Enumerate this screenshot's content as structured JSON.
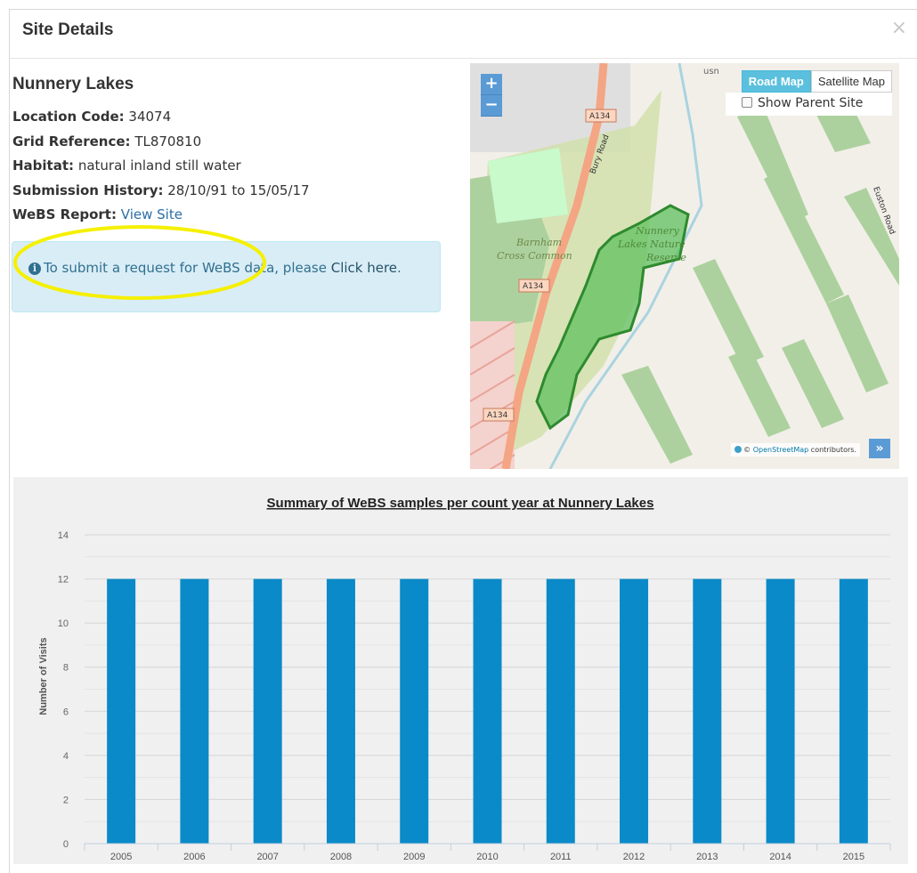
{
  "modal": {
    "title": "Site Details",
    "close_label": "×"
  },
  "site": {
    "name": "Nunnery Lakes",
    "details": [
      {
        "label": "Location Code:",
        "value": "34074"
      },
      {
        "label": "Grid Reference:",
        "value": "TL870810"
      },
      {
        "label": "Habitat:",
        "value": "natural inland still water"
      },
      {
        "label": "Submission History:",
        "value": "28/10/91 to 15/05/17"
      }
    ],
    "webs_report_label": "WeBS Report:",
    "webs_report_link": "View Site"
  },
  "alert": {
    "text": "To submit a request for WeBS data, please ",
    "link": "Click here",
    "end": "."
  },
  "map": {
    "zoom_in": "+",
    "zoom_out": "−",
    "road_map": "Road Map",
    "satellite_map": "Satellite Map",
    "show_parent_site": "Show Parent Site",
    "attribution_link": "OpenStreetMap",
    "attribution_text": " contributors.",
    "expand": "»",
    "labels": {
      "road_a134": "A134",
      "bury_road": "Bury Road",
      "barnham": "Barnham",
      "cross_common": "Cross Common",
      "nunnery": "Nunnery",
      "lakes_nature": "Lakes Nature",
      "reserve": "Reserve",
      "euston_road": "Euston Road",
      "usn": "usn"
    },
    "colors": {
      "background": "#f2efe9",
      "reserve_fill": "#5fc05f",
      "reserve_stroke": "#2e8a2e",
      "common": "#cfe0a8",
      "wood": "#add19e",
      "road": "#f4a583"
    }
  },
  "chart_data": {
    "type": "bar",
    "title": "Summary of WeBS samples per count year at Nunnery Lakes",
    "xlabel": "",
    "ylabel": "Number of Visits",
    "categories": [
      "2005",
      "2006",
      "2007",
      "2008",
      "2009",
      "2010",
      "2011",
      "2012",
      "2013",
      "2014",
      "2015"
    ],
    "values": [
      12,
      12,
      12,
      12,
      12,
      12,
      12,
      12,
      12,
      12,
      12
    ],
    "ylim": [
      0,
      14
    ],
    "yticks": [
      0,
      2,
      4,
      6,
      8,
      10,
      12,
      14
    ],
    "grid": true,
    "bar_color": "#0a8ac8"
  }
}
